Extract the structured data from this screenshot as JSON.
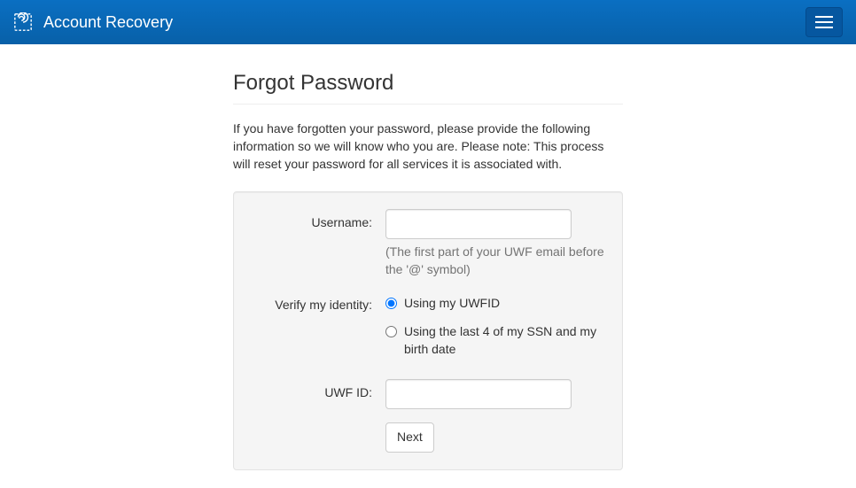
{
  "navbar": {
    "title": "Account Recovery"
  },
  "page": {
    "heading": "Forgot Password",
    "intro": "If you have forgotten your password, please provide the following information so we will know who you are. Please note: This process will reset your password for all services it is associated with."
  },
  "form": {
    "username": {
      "label": "Username:",
      "value": "",
      "help": "(The first part of your UWF email before the '@' symbol)"
    },
    "verify": {
      "label": "Verify my identity:",
      "options": {
        "uwfid": "Using my UWFID",
        "ssn": "Using the last 4 of my SSN and my birth date"
      },
      "selected": "uwfid"
    },
    "uwfid": {
      "label": "UWF ID:",
      "value": ""
    },
    "next_label": "Next"
  }
}
